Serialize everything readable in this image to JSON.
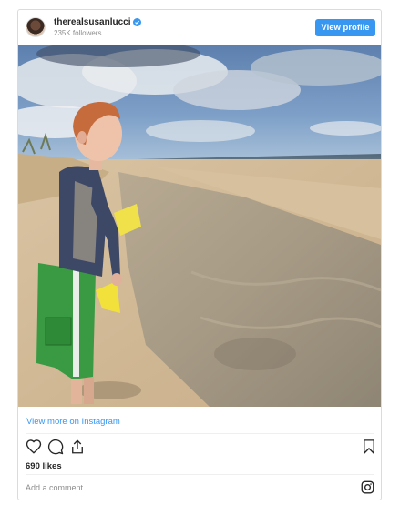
{
  "header": {
    "username": "therealsusanlucci",
    "followers": "235K followers",
    "view_profile_label": "View profile",
    "verified_icon": "verified-badge-icon"
  },
  "post": {
    "image_alt": "Boy standing on a beach looking at the ocean",
    "view_more_label": "View more on Instagram",
    "likes": "690 likes",
    "comment_placeholder": "Add a comment..."
  },
  "icons": {
    "like": "heart-icon",
    "comment": "comment-icon",
    "share": "share-icon",
    "save": "bookmark-icon",
    "instagram": "instagram-logo-icon"
  },
  "colors": {
    "accent": "#3897f0",
    "text": "#262626",
    "muted": "#8e8e8e",
    "border": "#dbdbdb"
  }
}
